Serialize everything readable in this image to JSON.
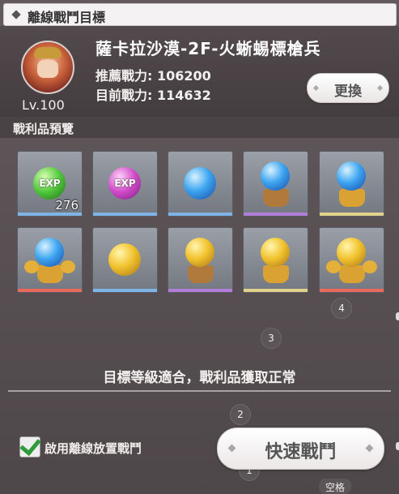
{
  "window": {
    "title": "離線戰鬥目標"
  },
  "header": {
    "level": "Lv.100",
    "stage_name": "薩卡拉沙漠-2F-火蜥蜴標槍兵",
    "recommended_power": "推薦戰力: 106200",
    "current_power": "目前戰力: 114632",
    "change_label": "更換"
  },
  "loot": {
    "title": "戰利品預覽",
    "items": [
      {
        "icon": "exp-green-orb-icon",
        "qty": "276",
        "rarity_color": "#7fb4e6"
      },
      {
        "icon": "exp-purple-orb-icon",
        "qty": "",
        "rarity_color": "#7fb4e6"
      },
      {
        "icon": "blue-orb-icon",
        "qty": "",
        "rarity_color": "#7fb4e6"
      },
      {
        "icon": "blue-orb-stand-icon",
        "qty": "",
        "rarity_color": "#b07ed8"
      },
      {
        "icon": "blue-orb-gold-stand-icon",
        "qty": "",
        "rarity_color": "#e0d28a"
      },
      {
        "icon": "blue-orb-winged-stand-icon",
        "qty": "",
        "rarity_color": "#e86a5c"
      },
      {
        "icon": "gold-orb-icon",
        "qty": "",
        "rarity_color": "#7fb4e6"
      },
      {
        "icon": "gold-orb-stand-icon",
        "qty": "",
        "rarity_color": "#b07ed8"
      },
      {
        "icon": "gold-orb-gold-stand-icon",
        "qty": "",
        "rarity_color": "#e0d28a"
      },
      {
        "icon": "gold-orb-winged-stand-icon",
        "qty": "",
        "rarity_color": "#e86a5c"
      }
    ]
  },
  "markers": [
    "4",
    "3",
    "2",
    "1"
  ],
  "status_text": "目標等級適合，戰利品獲取正常",
  "auto_offline": {
    "label": "啟用離線放置戰鬥",
    "checked": true
  },
  "fast_battle_label": "快速戰鬥",
  "space_key_label": "空格"
}
